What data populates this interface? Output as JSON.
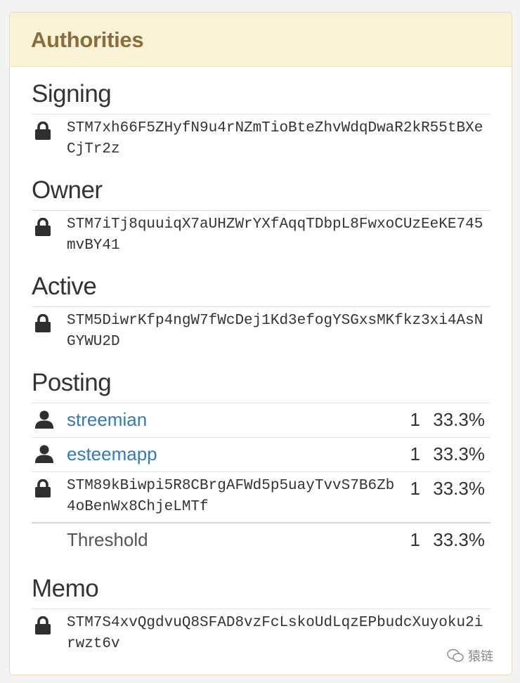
{
  "panel": {
    "title": "Authorities"
  },
  "sections": {
    "signing": {
      "title": "Signing",
      "key": "STM7xh66F5ZHyfN9u4rNZmTioBteZhvWdqDwaR2kR55tBXeCjTr2z"
    },
    "owner": {
      "title": "Owner",
      "key": "STM7iTj8quuiqX7aUHZWrYXfAqqTDbpL8FwxoCUzEeKE745mvBY41"
    },
    "active": {
      "title": "Active",
      "key": "STM5DiwrKfp4ngW7fWcDej1Kd3efogYSGxsMKfkz3xi4AsNGYWU2D"
    },
    "posting": {
      "title": "Posting",
      "rows": [
        {
          "type": "account",
          "label": "streemian",
          "weight": "1",
          "percent": "33.3%"
        },
        {
          "type": "account",
          "label": "esteemapp",
          "weight": "1",
          "percent": "33.3%"
        },
        {
          "type": "key",
          "label": "STM89kBiwpi5R8CBrgAFWd5p5uayTvvS7B6Zb4oBenWx8ChjeLMTf",
          "weight": "1",
          "percent": "33.3%"
        }
      ],
      "threshold": {
        "label": "Threshold",
        "weight": "1",
        "percent": "33.3%"
      }
    },
    "memo": {
      "title": "Memo",
      "key": "STM7S4xvQgdvuQ8SFAD8vzFcLskoUdLqzEPbudcXuyoku2irwzt6v"
    }
  },
  "icons": {
    "key": "lock-icon",
    "account": "user-icon"
  },
  "colors": {
    "header_bg": "#fbf3d8",
    "header_text": "#8a6d3b",
    "link": "#337ab7"
  },
  "watermark": {
    "text": "猿链"
  }
}
